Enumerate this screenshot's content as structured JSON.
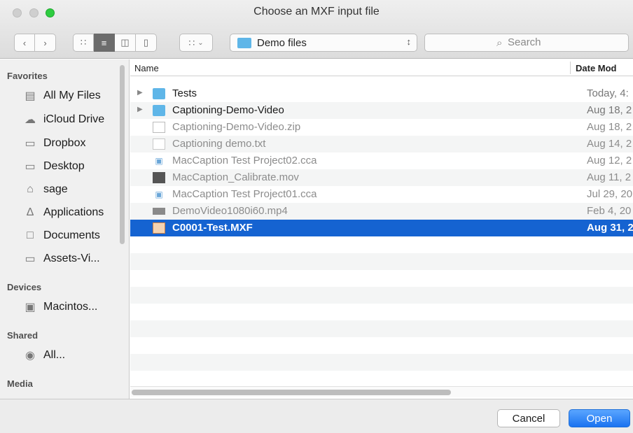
{
  "window": {
    "title": "Choose an MXF input file"
  },
  "toolbar": {
    "back_icon": "chevron-left-icon",
    "forward_icon": "chevron-right-icon",
    "view_modes": [
      "icon-view",
      "list-view",
      "column-view",
      "cover-flow-view"
    ],
    "active_view": "list-view",
    "arrange_icon": "arrange-grid-icon",
    "location": "Demo files",
    "search_placeholder": "Search"
  },
  "sidebar": {
    "favorites_title": "Favorites",
    "favorites": [
      {
        "label": "All My Files",
        "icon": "all-files-icon"
      },
      {
        "label": "iCloud Drive",
        "icon": "cloud-icon"
      },
      {
        "label": "Dropbox",
        "icon": "folder-icon"
      },
      {
        "label": "Desktop",
        "icon": "desktop-folder-icon"
      },
      {
        "label": "sage",
        "icon": "home-icon"
      },
      {
        "label": "Applications",
        "icon": "applications-icon"
      },
      {
        "label": "Documents",
        "icon": "documents-icon"
      },
      {
        "label": "Assets-Vi...",
        "icon": "folder-icon"
      }
    ],
    "devices_title": "Devices",
    "devices": [
      {
        "label": "Macintos...",
        "icon": "hard-disk-icon"
      }
    ],
    "shared_title": "Shared",
    "shared": [
      {
        "label": "All...",
        "icon": "network-globe-icon"
      }
    ],
    "media_title": "Media"
  },
  "file_list": {
    "columns": [
      "Name",
      "Date Mod"
    ],
    "rows": [
      {
        "name": "Tests",
        "date": "Today, 4:",
        "type": "folder",
        "expandable": true,
        "enabled": true,
        "selected": false
      },
      {
        "name": "Captioning-Demo-Video",
        "date": "Aug 18, 2",
        "type": "folder",
        "expandable": true,
        "enabled": true,
        "selected": false
      },
      {
        "name": "Captioning-Demo-Video.zip",
        "date": "Aug 18, 2",
        "type": "zip",
        "expandable": false,
        "enabled": false,
        "selected": false
      },
      {
        "name": "Captioning demo.txt",
        "date": "Aug 14, 2",
        "type": "txt",
        "expandable": false,
        "enabled": false,
        "selected": false
      },
      {
        "name": "MacCaption Test Project02.cca",
        "date": "Aug 12, 2",
        "type": "cca",
        "expandable": false,
        "enabled": false,
        "selected": false
      },
      {
        "name": "MacCaption_Calibrate.mov",
        "date": "Aug 11, 2",
        "type": "mov",
        "expandable": false,
        "enabled": false,
        "selected": false
      },
      {
        "name": "MacCaption Test Project01.cca",
        "date": "Jul 29, 20",
        "type": "cca",
        "expandable": false,
        "enabled": false,
        "selected": false
      },
      {
        "name": "DemoVideo1080i60.mp4",
        "date": "Feb 4, 20",
        "type": "mp4",
        "expandable": false,
        "enabled": false,
        "selected": false
      },
      {
        "name": "C0001-Test.MXF",
        "date": "Aug 31, 2",
        "type": "mxf",
        "expandable": false,
        "enabled": true,
        "selected": true
      }
    ]
  },
  "buttons": {
    "cancel": "Cancel",
    "open": "Open"
  },
  "colors": {
    "selection": "#1563d1",
    "folder": "#5fb6e8",
    "primary_button": "#1a73f0"
  }
}
